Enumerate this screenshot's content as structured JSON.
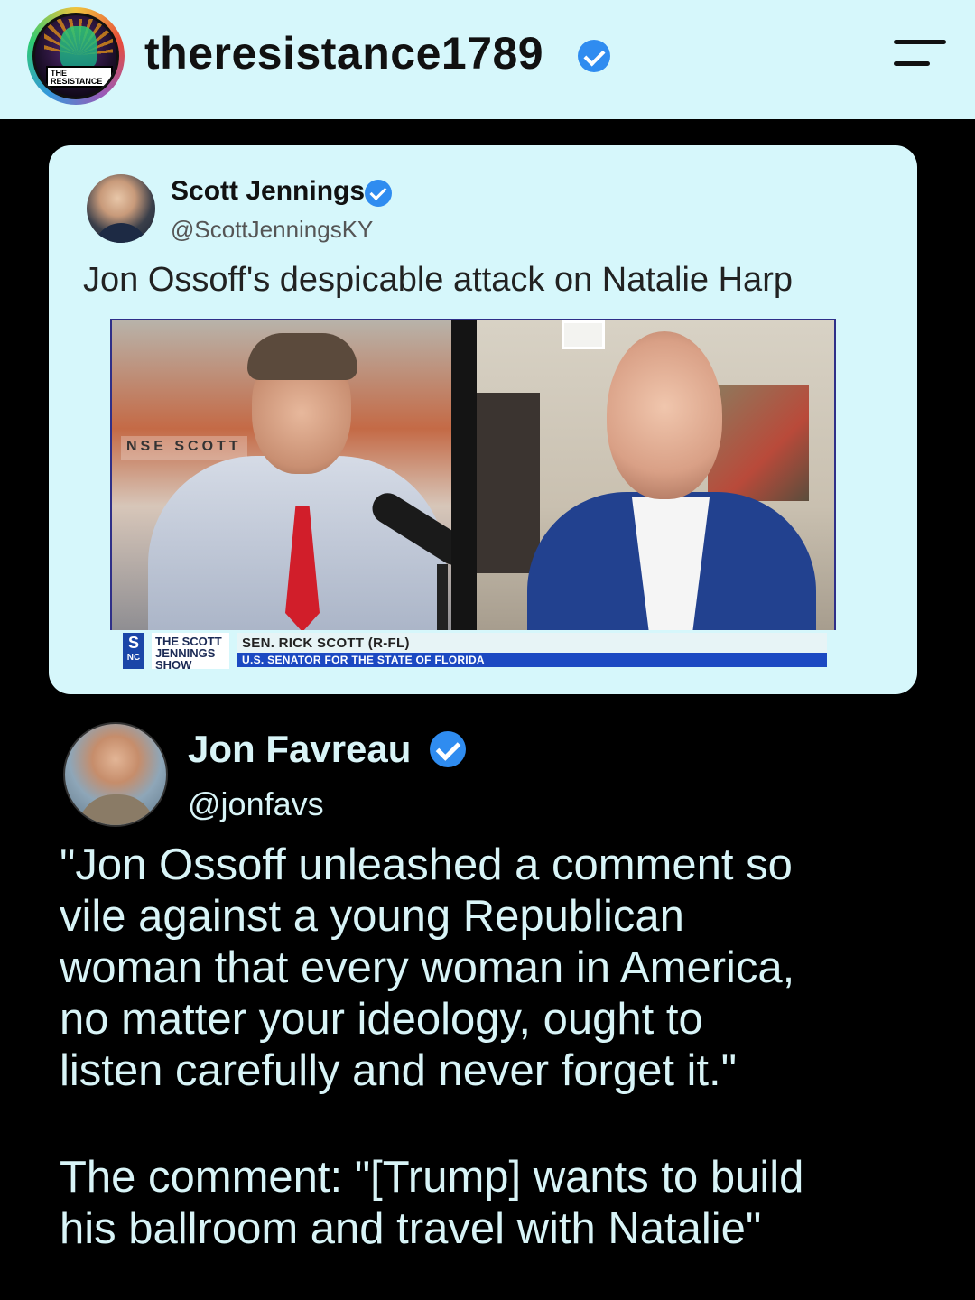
{
  "header": {
    "avatar_badge": "THE RESISTANCE",
    "username": "theresistance1789",
    "verified_icon": "verified-badge-icon",
    "menu_icon": "menu-icon"
  },
  "embedded_tweet": {
    "author_name": "Scott Jennings",
    "author_handle": "@ScottJenningsKY",
    "text": "Jon Ossoff's despicable attack on Natalie Harp",
    "video": {
      "wall_sign": "NSE SCOTT",
      "chyron_network": "S",
      "chyron_network_sub": "NC",
      "chyron_show": "THE SCOTT JENNINGS SHOW",
      "chyron_title": "SEN. RICK SCOTT (R-FL)",
      "chyron_subtitle": "U.S. SENATOR FOR THE STATE OF FLORIDA"
    }
  },
  "main_tweet": {
    "author_name": "Jon Favreau",
    "author_handle": "@jonfavs",
    "quote_line1": "\"Jon Ossoff unleashed a comment so",
    "quote_line2": "vile against a young Republican",
    "quote_line3": "woman that every woman in America,",
    "quote_line4": "no matter your ideology, ought to",
    "quote_line5": "listen carefully and never forget it.\"",
    "comment_line1": "The comment: \"[Trump] wants to build",
    "comment_line2": "his ballroom and travel with Natalie\""
  },
  "colors": {
    "header_bg": "#d6f7fb",
    "card_bg": "#d6f7fb",
    "page_bg": "#000000",
    "tweet_text": "#d8f4f7",
    "verified_blue": "#2f8cf0"
  }
}
